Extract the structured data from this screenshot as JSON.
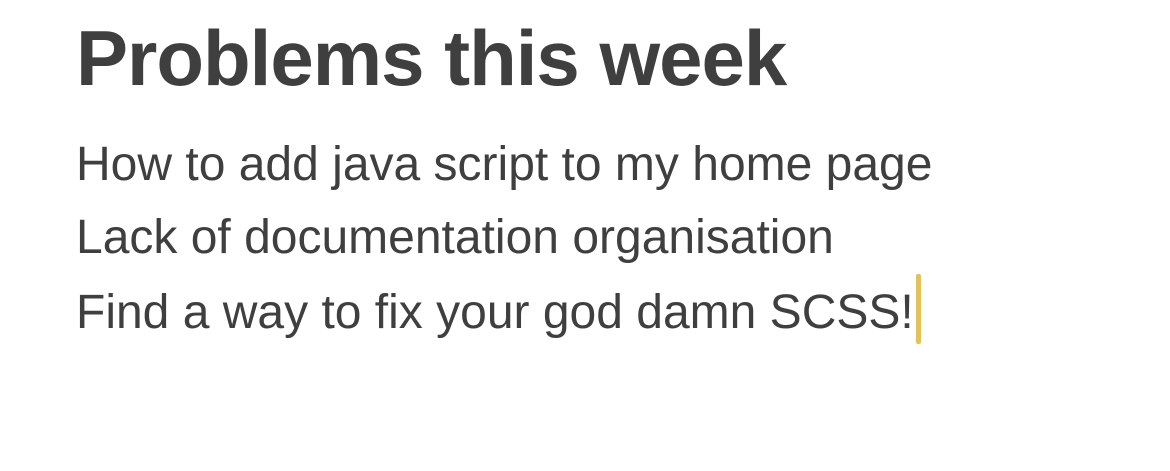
{
  "note": {
    "title": "Problems this week",
    "lines": [
      "How to add java script to my home page",
      "Lack of documentation organisation",
      "Find a way to fix your god damn SCSS!"
    ]
  },
  "colors": {
    "text": "#3f3f3f",
    "caret": "#e2c35a",
    "background": "#ffffff"
  }
}
